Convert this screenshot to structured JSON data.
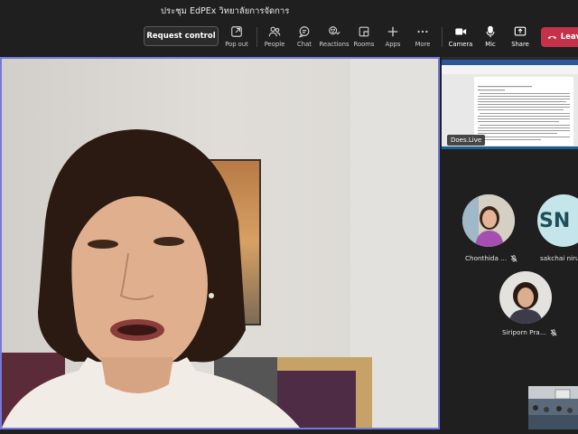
{
  "meeting": {
    "title": "ประชุม EdPEx วิทยาลัยการจัดการ"
  },
  "toolbar": {
    "request_control": "Request control",
    "items": [
      {
        "label": "Pop out",
        "icon": "pop-out-icon"
      },
      {
        "label": "People",
        "icon": "people-icon"
      },
      {
        "label": "Chat",
        "icon": "chat-icon"
      },
      {
        "label": "Reactions",
        "icon": "reactions-icon"
      },
      {
        "label": "Rooms",
        "icon": "rooms-icon"
      },
      {
        "label": "Apps",
        "icon": "apps-icon"
      },
      {
        "label": "More",
        "icon": "more-icon"
      },
      {
        "label": "Camera",
        "icon": "camera-icon"
      },
      {
        "label": "Mic",
        "icon": "mic-icon"
      },
      {
        "label": "Share",
        "icon": "share-icon"
      }
    ],
    "leave_label": "Leave",
    "leave_color": "#c4314b"
  },
  "main_speaker": {
    "highlight_color": "#7479dc"
  },
  "share": {
    "label": "Does.Live"
  },
  "participants": [
    {
      "name": "Chonthida ...",
      "icon": "mic-off-icon"
    },
    {
      "name": "sakchai nirunt",
      "initials": "SN",
      "icon": "mic-off-icon"
    },
    {
      "name": "Siriporn Pra...",
      "icon": "mic-off-icon"
    }
  ]
}
